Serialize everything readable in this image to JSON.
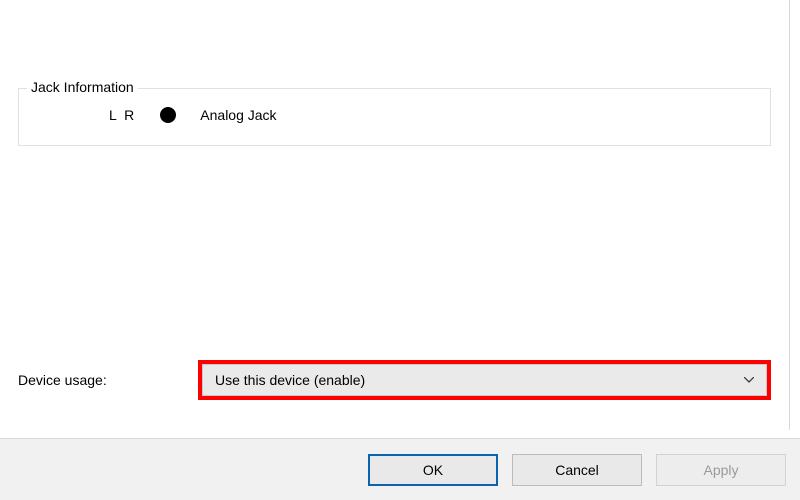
{
  "jackInfo": {
    "title": "Jack Information",
    "channels": "L R",
    "jackColor": "#000000",
    "jackType": "Analog Jack"
  },
  "deviceUsage": {
    "label": "Device usage:",
    "selected": "Use this device (enable)"
  },
  "buttons": {
    "ok": "OK",
    "cancel": "Cancel",
    "apply": "Apply"
  },
  "highlightColor": "#ff0000"
}
